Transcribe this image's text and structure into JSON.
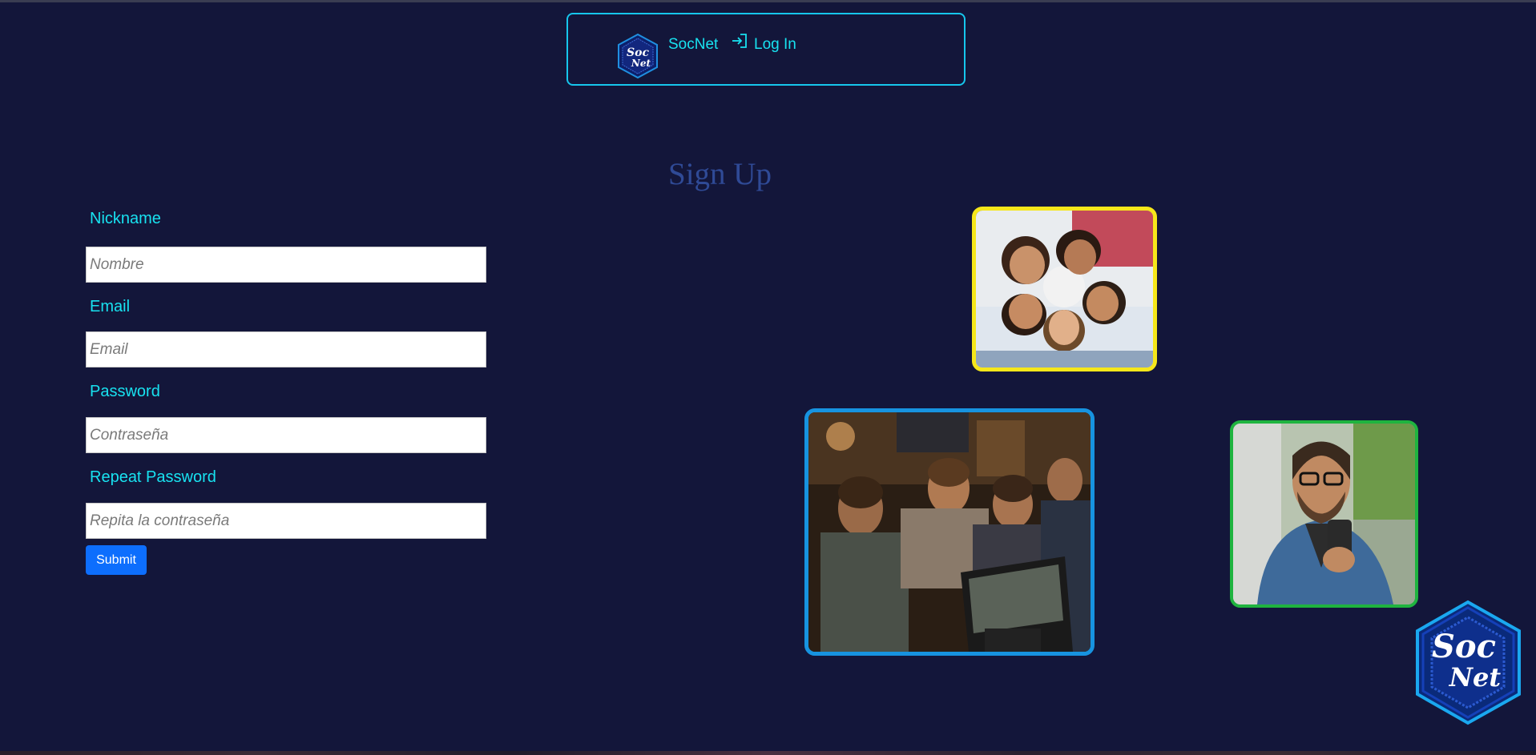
{
  "navbar": {
    "brand": "SocNet",
    "login": "Log In",
    "logo_text_1": "Soc",
    "logo_text_2": "Net",
    "icons": [
      "socnet-logo-icon",
      "login-icon"
    ]
  },
  "title": "Sign Up",
  "form": {
    "nickname_label": "Nickname",
    "nickname_placeholder": "Nombre",
    "email_label": "Email",
    "email_placeholder": "Email",
    "password_label": "Password",
    "password_placeholder": "Contraseña",
    "repeat_label": "Repeat Password",
    "repeat_placeholder": "Repita la contraseña",
    "submit": "Submit"
  },
  "photos": [
    {
      "name": "group-selfie-photo",
      "border_color": "#f6e71a"
    },
    {
      "name": "friends-at-computer-photo",
      "border_color": "#1793e0"
    },
    {
      "name": "man-with-phone-photo",
      "border_color": "#1fb43f"
    }
  ],
  "colors": {
    "background": "#13163a",
    "accent": "#18e2f0",
    "title": "#2f4a96",
    "button": "#0d6efd"
  }
}
